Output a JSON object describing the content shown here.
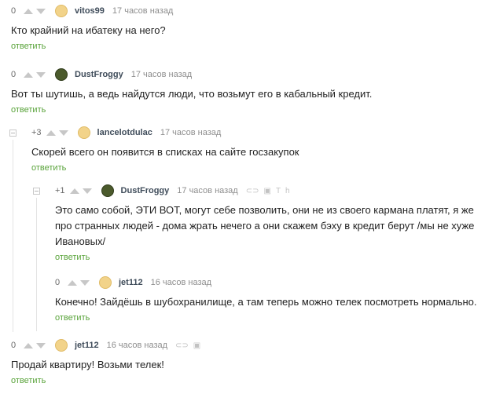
{
  "comments": [
    {
      "rating": "0",
      "username": "vitos99",
      "time": "17 часов назад",
      "text": "Кто крайний на ибатеку на него?",
      "reply": "ответить",
      "avatar": "default-avatar"
    },
    {
      "rating": "0",
      "username": "DustFroggy",
      "time": "17 часов назад",
      "text": "Вот ты шутишь, а ведь найдутся люди, что возьмут его в кабальный кредит.",
      "reply": "ответить",
      "avatar": "frog-avatar"
    },
    {
      "rating": "+3",
      "username": "lancelotdulac",
      "time": "17 часов назад",
      "text": "Скорей всего он появится в списках на сайте госзакупок",
      "reply": "ответить",
      "avatar": "default-avatar"
    },
    {
      "rating": "+1",
      "username": "DustFroggy",
      "time": "17 часов назад",
      "text": "Это само собой, ЭТИ ВОТ, могут себе позволить, они не из своего кармана платят, я же про странных людей - дома жрать нечего а они скажем бэху в кредит берут /мы не хуже Ивановых/",
      "reply": "ответить",
      "avatar": "frog-avatar",
      "tools": [
        "link-icon",
        "save-icon",
        "text-size-icon",
        "hide-icon"
      ]
    },
    {
      "rating": "0",
      "username": "jet112",
      "time": "16 часов назад",
      "text": "Конечно! Зайдёшь в шубохранилище, а там теперь можно телек посмотреть нормально.",
      "reply": "ответить",
      "avatar": "default-avatar"
    },
    {
      "rating": "0",
      "username": "jet112",
      "time": "16 часов назад",
      "text": "Продай квартиру! Возьми телек!",
      "reply": "ответить",
      "avatar": "default-avatar",
      "tools": [
        "link-icon",
        "save-icon"
      ]
    }
  ],
  "colors": {
    "reply_link": "#59a33a",
    "username": "#3f4c5a",
    "meta": "#8a8a8a"
  }
}
